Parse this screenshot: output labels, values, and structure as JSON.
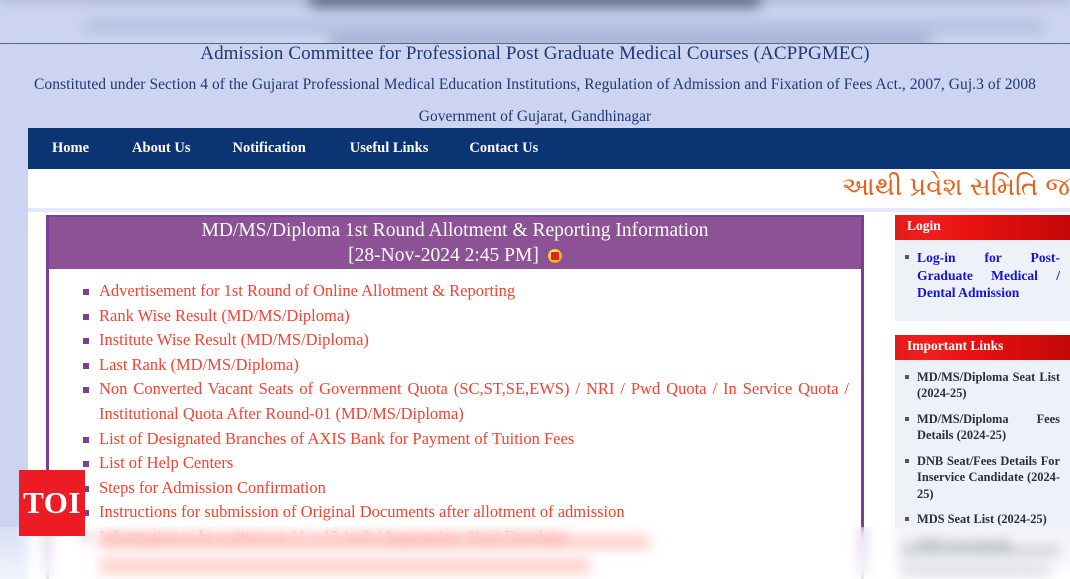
{
  "header": {
    "org_title": "Admission Committee for Professional Post Graduate Medical Courses (ACPPGMEC)",
    "constituted_line": "Constituted under Section 4 of the Gujarat Professional Medical Education Institutions, Regulation of Admission and Fixation of Fees Act., 2007, Guj.3 of 2008",
    "government_line": "Government of Gujarat, Gandhinagar"
  },
  "nav": {
    "items": [
      {
        "label": "Home"
      },
      {
        "label": "About Us"
      },
      {
        "label": "Notification"
      },
      {
        "label": "Useful Links"
      },
      {
        "label": "Contact Us"
      }
    ]
  },
  "marquee": {
    "text": "આથી પ્રવેશ સમિતિ જ"
  },
  "panel": {
    "title_line1": "MD/MS/Diploma 1st Round Allotment & Reporting Information",
    "title_line2": "[28-Nov-2024 2:45 PM]",
    "new_icon": "new-badge-icon",
    "items": [
      "Advertisement for 1st Round of Online Allotment & Reporting",
      "Rank Wise Result (MD/MS/Diploma)",
      "Institute Wise Result (MD/MS/Diploma)",
      "Last Rank (MD/MS/Diploma)",
      "Non Converted Vacant Seats of Government Quota (SC,ST,SE,EWS) / NRI / Pwd Quota / In Service Quota / Institutional Quota After Round-01 (MD/MS/Diploma)",
      "List of Designated Branches of AXIS Bank for Payment of Tuition Fees",
      "List of Help Centers",
      "Steps for Admission Confirmation",
      "Instructions for submission of Original Documents after allotment of admission",
      "Information to be written on 11 x 15-inch (Appropriate Size) Envelope"
    ]
  },
  "sidebar": {
    "login": {
      "heading": "Login",
      "items": [
        "Log-in for Post-Graduate Medical / Dental Admission"
      ]
    },
    "important_links": {
      "heading": "Important Links",
      "items": [
        "MD/MS/Diploma Seat List (2024-25)",
        "MD/MS/Diploma Fees Details (2024-25)",
        "DNB Seat/Fees Details For Inservice Candidate (2024-25)",
        "MDS Seat List (2024-25)",
        "MDS Fees Details"
      ]
    }
  },
  "watermark": {
    "label": "TOI"
  },
  "colors": {
    "page_background": "#ccd4f2",
    "nav_background": "#0b3472",
    "header_text": "#1d3a75",
    "panel_header": "#8d5296",
    "panel_border": "#7b3f98",
    "link_red": "#f7412f",
    "sidebar_head": "#e01b1b",
    "login_link": "#1414d6",
    "marquee_orange": "#e8621c",
    "watermark_red": "#ed1c24"
  }
}
